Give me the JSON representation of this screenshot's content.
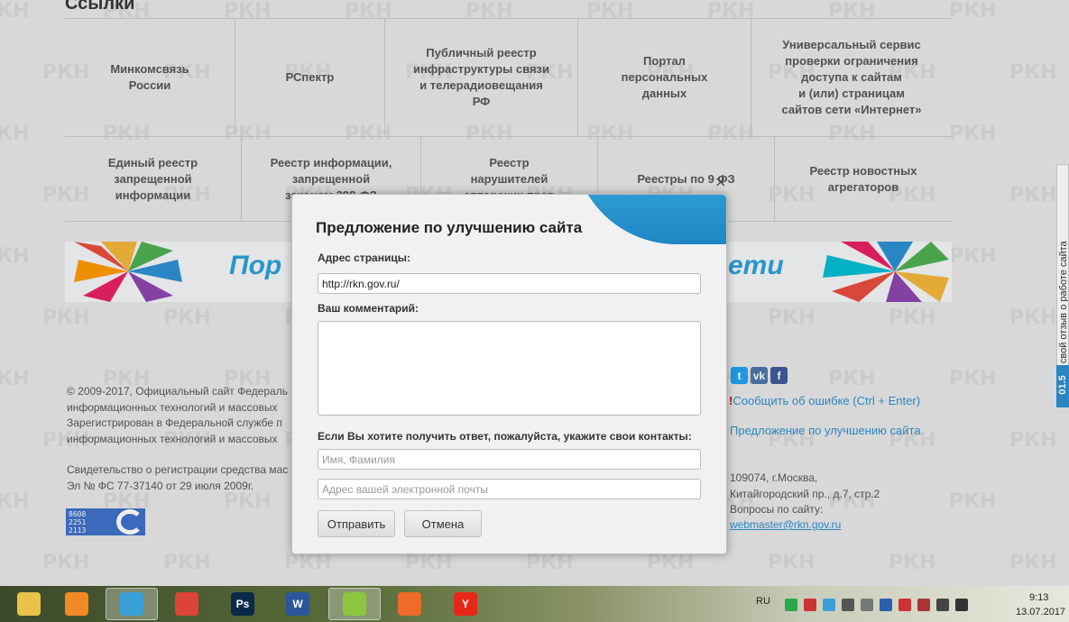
{
  "links_title": "Ссылки",
  "links_row1": [
    "Минкомсвязь\nРоссии",
    "РСпектр",
    "Публичный реестр\nинфраструктуры связи\nи телерадиовещания\nРФ",
    "Портал\nперсональных\nданных",
    "Универсальный сервис\nпроверки ограничения\nдоступа к сайтам\nи (или) страницам\nсайтов сети «Интернет»"
  ],
  "links_row2": [
    "Единый реестр\nзапрещенной\nинформации",
    "Реестр информации,\nзапрещенной\nзаконом 398-ФЗ",
    "Реестр\nнарушителей\nавторских прав",
    "Реестры по 9 ФЗ",
    "Реестр новостных\nагрегаторов"
  ],
  "banner": {
    "left_text": "Пор",
    "right_text": "ети"
  },
  "watermark": "РКН",
  "footer": {
    "copyright": "© 2009-2017, Официальный сайт Федераль\nинформационных технологий и массовых\nЗарегистрирован в Федеральной службе п\nинформационных технологий и массовых",
    "certificate": "Свидетельство о регистрации средства мас\nЭл № ФС 77-37140 от 29 июля 2009г.",
    "counter": "8608\n2251\n2113",
    "report_error": "Сообщить об ошибке (Ctrl + Enter)",
    "suggest": "Предложение по улучшению сайта",
    "address": "109074, г.Москва,\nКитайгородский пр., д.7, стр.2\nВопросы по сайту:",
    "email": "webmaster@rkn.gov.ru",
    "social": [
      "t",
      "vk",
      "f"
    ]
  },
  "side_tab": {
    "text": "Оставьте свой отзыв о работе сайта",
    "number": "01.5"
  },
  "dialog": {
    "title": "Предложение по улучшению сайта",
    "close_glyph": "×",
    "page_address_label": "Адрес страницы:",
    "page_address_value": "http://rkn.gov.ru/",
    "comment_label": "Ваш комментарий:",
    "comment_value": "",
    "contacts_label": "Если Вы хотите получить ответ, пожалуйста, укажите свои контакты:",
    "name_placeholder": "Имя, Фамилия",
    "email_placeholder": "Адрес вашей электронной почты",
    "submit_label": "Отправить",
    "cancel_label": "Отмена"
  },
  "taskbar": {
    "apps": [
      {
        "name": "explorer-icon",
        "label": "",
        "color": "#e9c24a"
      },
      {
        "name": "media-player-icon",
        "label": "",
        "color": "#f08a24"
      },
      {
        "name": "bird-app-icon",
        "label": "",
        "color": "#3aa0d8"
      },
      {
        "name": "chrome-icon",
        "label": "",
        "color": "#db4437"
      },
      {
        "name": "photoshop-icon",
        "label": "Ps",
        "color": "#0a2a4a"
      },
      {
        "name": "word-icon",
        "label": "W",
        "color": "#2b579a"
      },
      {
        "name": "notepad-plus-icon",
        "label": "",
        "color": "#8cc63f"
      },
      {
        "name": "paint-app-icon",
        "label": "",
        "color": "#f06a2a"
      },
      {
        "name": "yandex-browser-icon",
        "label": "Y",
        "color": "#e8271b"
      }
    ],
    "lang": "RU",
    "time": "9:13",
    "date": "13.07.2017"
  }
}
